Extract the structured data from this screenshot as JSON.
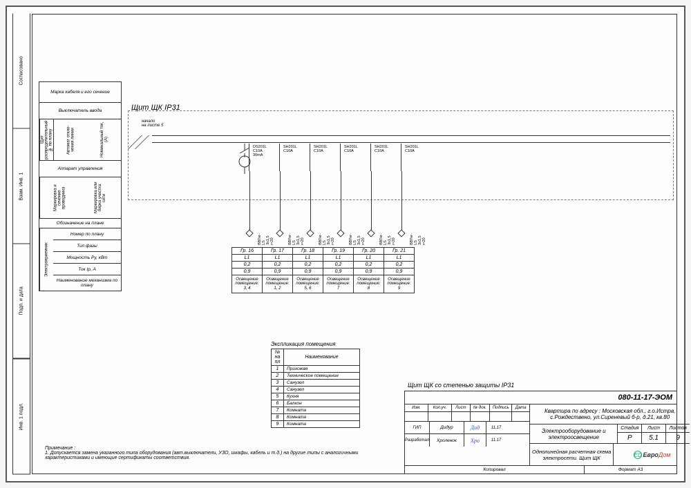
{
  "panel": {
    "title": "Щит ЩК  IP31",
    "note_top": "начало\nна листе 5"
  },
  "side_tabs": [
    "Инв. 1 подл.",
    "Подп. и дата",
    "Взам. Инв. 1",
    "Согласовано"
  ],
  "legend": {
    "r1": "Марка кабеля и\nего сечение",
    "r2": "Выключатель\nввода",
    "r3_a": "Щит распределительный\n№ по плану",
    "r3_b": "Автомат откло-\nчения линии",
    "r3_c": "Номинальный\nток, (А)",
    "r4": "Аппарат управления",
    "r5_a": "Маркировка и\nсечение\nпроводника",
    "r5_b": "Маркировка или\nбирка участка\nсети",
    "r6": "Обозначение на плане",
    "r7_a": "Электроприемник",
    "r7_rows": [
      "Номер по плану",
      "Тип фазы",
      "Мощность Ру, кВт",
      "Ток Iр, А",
      "Наименование\nмеханизма\nпо плану"
    ]
  },
  "breakers": [
    {
      "lbl": "DS201L\nC10А\n30mА"
    },
    {
      "lbl": "SH201L\nC10А"
    },
    {
      "lbl": "SH201L\nC10А"
    },
    {
      "lbl": "SH201L\nC10А"
    },
    {
      "lbl": "SH201L\nC10А"
    },
    {
      "lbl": "SH201L\nC10А"
    }
  ],
  "wire_label": "ВВГнг-LS 3x1,5 ɩ=20",
  "groups": {
    "hdr": [
      "Гр. 16",
      "Гр. 17",
      "Гр. 18",
      "Гр. 19",
      "Гр. 20",
      "Гр. 21"
    ],
    "phase": [
      "L1",
      "L1",
      "L1",
      "L1",
      "L1",
      "L1"
    ],
    "power": [
      "0,2",
      "0,2",
      "0,2",
      "0,2",
      "0,2",
      "0,2"
    ],
    "current": [
      "0,9",
      "0,9",
      "0,9",
      "0,9",
      "0,9",
      "0,9"
    ],
    "name": [
      "Освещение помещение: 3, 4",
      "Освещение помещение: 1, 2",
      "Освещение помещение: 5, 6",
      "Освещение помещение: 7",
      "Освещение помещение: 8",
      "Освещение помещение: 9"
    ]
  },
  "explication": {
    "title": "Экспликация помещения",
    "hdr": [
      "№ на пл",
      "Наименование"
    ],
    "rows": [
      [
        "1",
        "Прихожая"
      ],
      [
        "2",
        "Техническое помещение"
      ],
      [
        "3",
        "Санузел"
      ],
      [
        "4",
        "Санузел"
      ],
      [
        "5",
        "Кухня"
      ],
      [
        "6",
        "Балкон"
      ],
      [
        "7",
        "Комната"
      ],
      [
        "8",
        "Комната"
      ],
      [
        "9",
        "Комната"
      ]
    ]
  },
  "note": {
    "hdr": "Примечание :",
    "body": "1. Допускается замена указанного типа оборудования (авт.выключатели, УЗО, шкафы, кабель и т.д.) на другие типы с аналогичными характеристиками и имеющие сертификаты соответствия."
  },
  "panel_protection": "Щит ЩК со степенью защиты IP31",
  "title_block": {
    "proj_num": "080-11-17-ЭОМ",
    "address": "Квартира по адресу : Московская обл., г.о.Истра,\nс.Рождествено, ул.Сиреневый б-р, д.21, кв.80",
    "system": "Электрооборудование и\nэлектроосвещение",
    "sheet_name": "Однолинейная расчетная схема\nэлектросети. Щит ЩК",
    "cols": [
      "Изм.",
      "Кол.уч.",
      "Лист",
      "№ док.",
      "Подпись",
      "Дата"
    ],
    "roles": [
      {
        "role": "ГИП",
        "name": "Дидур",
        "sign": "Дид",
        "date": "11.17"
      },
      {
        "role": "Разработал",
        "name": "Хроленок",
        "sign": "Хро",
        "date": "11.17"
      }
    ],
    "stage_hdr": [
      "Стадия",
      "Лист",
      "Листов"
    ],
    "stage_val": [
      "Р",
      "5.1",
      "9"
    ],
    "logo": "Евро Дом",
    "bottom": [
      "Копировал",
      "Формат А3"
    ]
  }
}
